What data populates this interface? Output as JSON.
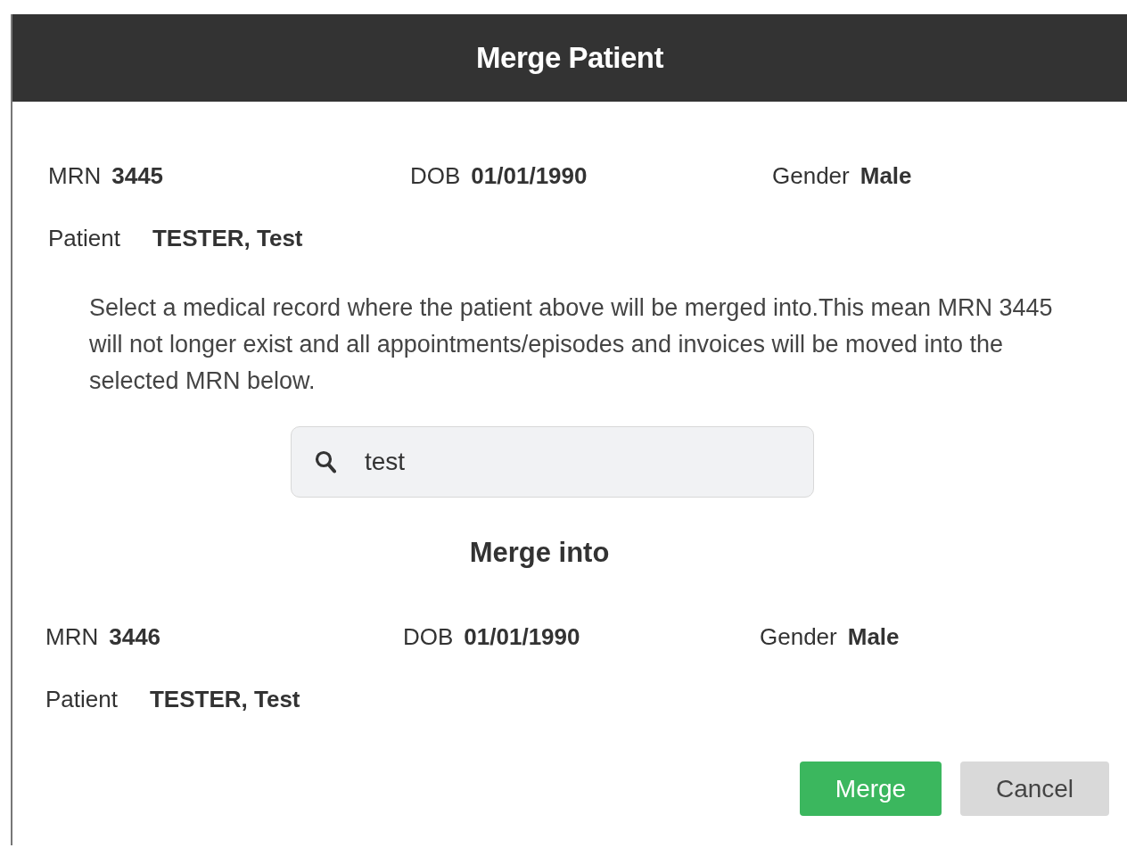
{
  "dialog": {
    "title": "Merge Patient"
  },
  "source": {
    "fields": [
      {
        "label": "MRN",
        "value": "3445"
      },
      {
        "label": "DOB",
        "value": "01/01/1990"
      },
      {
        "label": "Gender",
        "value": "Male"
      }
    ],
    "patient": {
      "label": "Patient",
      "value": "TESTER, Test"
    }
  },
  "instructions": "Select a medical record where the patient above will be merged into.This mean MRN 3445 will not longer exist and all appointments/episodes and invoices will be moved into the selected MRN below.",
  "search": {
    "value": "test"
  },
  "target_heading": "Merge into",
  "target": {
    "fields": [
      {
        "label": "MRN",
        "value": "3446"
      },
      {
        "label": "DOB",
        "value": "01/01/1990"
      },
      {
        "label": "Gender",
        "value": "Male"
      }
    ],
    "patient": {
      "label": "Patient",
      "value": "TESTER, Test"
    }
  },
  "buttons": [
    {
      "label": "Merge",
      "kind": "primary"
    },
    {
      "label": "Cancel",
      "kind": "secondary"
    }
  ]
}
